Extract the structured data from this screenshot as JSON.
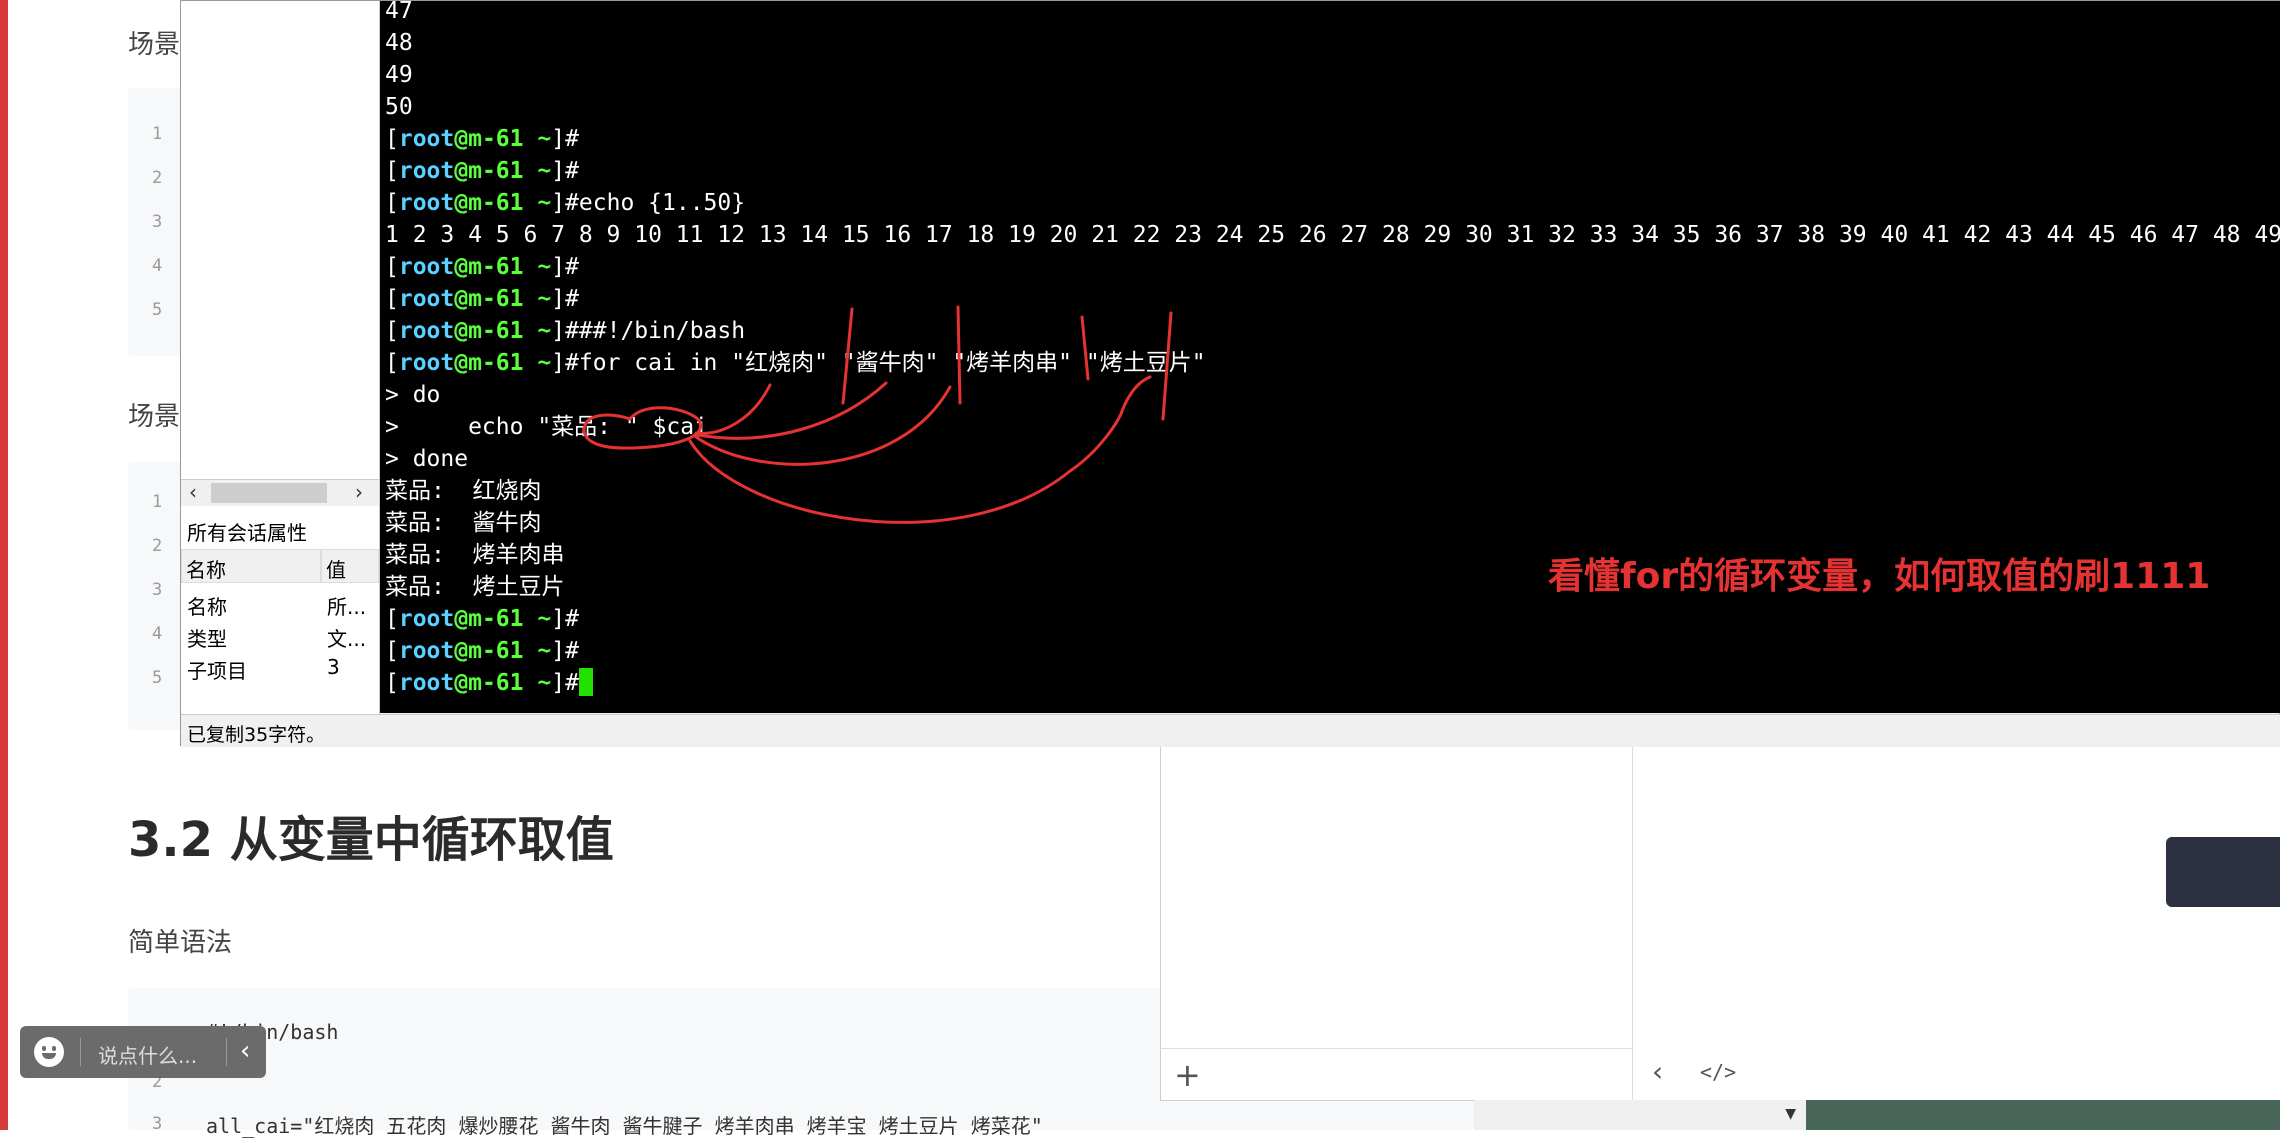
{
  "doc": {
    "scene1": "场景",
    "scene2": "场景",
    "line_numbers_a": [
      "1",
      "2",
      "3",
      "4",
      "5"
    ],
    "line_numbers_b": [
      "1",
      "2",
      "3",
      "4",
      "5"
    ],
    "heading": "3.2 从变量中循环取值",
    "simple_syntax": "简单语法",
    "code_lines": [
      {
        "num": "1",
        "text": "#!/bin/bash"
      },
      {
        "num": "2",
        "text": ""
      },
      {
        "num": "3",
        "text": "all_cai=\"红烧肉 五花肉 爆炒腰花 酱牛肉 酱牛腱子 烤羊肉串 烤羊宝 烤土豆片 烤菜花\""
      }
    ]
  },
  "comment_box": {
    "placeholder": "说点什么..."
  },
  "session_panel": {
    "properties_title": "所有会话属性",
    "col_name": "名称",
    "col_value": "值",
    "rows": [
      {
        "name": "名称",
        "value": "所..."
      },
      {
        "name": "类型",
        "value": "文..."
      },
      {
        "name": "子项目",
        "value": "3"
      }
    ]
  },
  "status_bar": {
    "text": "已复制35字符。"
  },
  "terminal": {
    "user": "root",
    "host": "m-61",
    "cwd": "~",
    "seq_tail": [
      "47",
      "48",
      "49",
      "50"
    ],
    "commands": [
      "",
      "",
      "echo {1..50}"
    ],
    "echo_output": "1 2 3 4 5 6 7 8 9 10 11 12 13 14 15 16 17 18 19 20 21 22 23 24 25 26 27 28 29 30 31 32 33 34 35 36 37 38 39 40 41 42 43 44 45 46 47 48 49",
    "commands2": [
      "",
      "",
      "##!/bin/bash",
      "for cai in \"红烧肉\" \"酱牛肉\" \"烤羊肉串\" \"烤土豆片\""
    ],
    "continuation": [
      "> do",
      ">     echo \"菜品: \" $cai",
      "> done"
    ],
    "results": [
      "菜品:  红烧肉",
      "菜品:  酱牛肉",
      "菜品:  烤羊肉串",
      "菜品:  烤土豆片"
    ],
    "final_prompts": [
      "",
      "",
      ""
    ]
  },
  "annotation": "看懂for的循环变量，如何取值的刷1111",
  "colors": {
    "terminal_bg": "#000000",
    "prompt_user": "#5ad1ff",
    "prompt_host": "#5aff3c",
    "annotation": "#e53232",
    "cursor": "#22e000"
  }
}
